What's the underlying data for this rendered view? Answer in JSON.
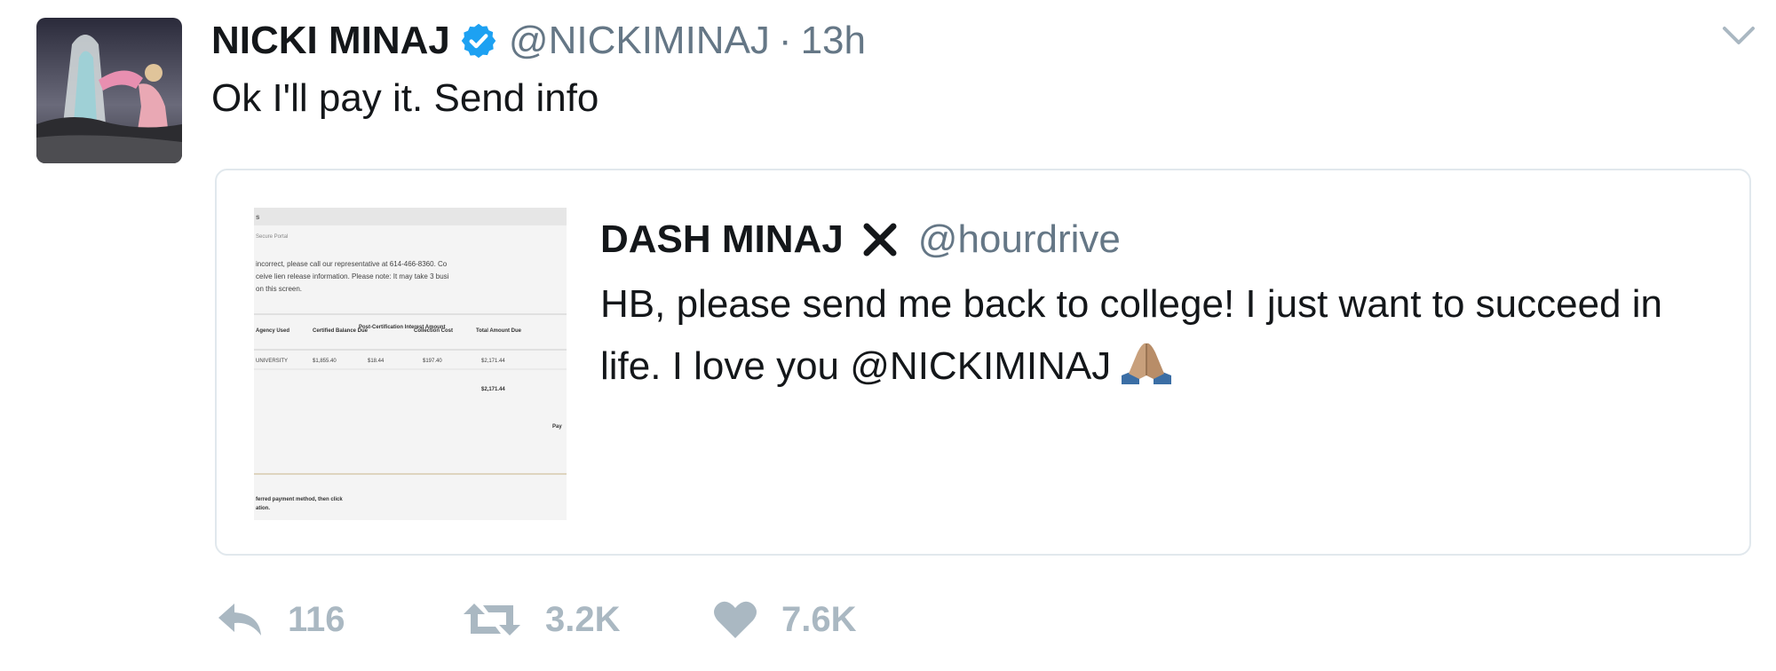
{
  "tweet": {
    "author_name": "NICKI MINAJ",
    "handle": "@NICKIMINAJ",
    "separator": "·",
    "time": "13h",
    "text": "Ok I'll pay it. Send info"
  },
  "quoted": {
    "author_name": "DASH MINAJ",
    "name_emoji": "heavy-x-icon",
    "handle": "@hourdrive",
    "text": "HB, please send me back to college! I just want to succeed in life. I love you @NICKIMINAJ",
    "emoji": "folded-hands-icon",
    "image": {
      "lines": [
        "incorrect, please call our representative at 614-466-8360. Co",
        "ceive lien release information. Please note: It may take 3 busi",
        "on this screen."
      ],
      "table_headers": [
        "Agency Used",
        "Certified Balance Due",
        "Post-Certification Interest Amount",
        "Collection Cost",
        "Total Amount Due"
      ],
      "table_row": [
        "UNIVERSITY",
        "$1,855.40",
        "$18.44",
        "$197.40",
        "$2,171.44"
      ],
      "total": "$2,171.44",
      "footer": "ferred payment method, then click"
    }
  },
  "actions": {
    "reply_count": "116",
    "retweet_count": "3.2K",
    "like_count": "7.6K"
  },
  "colors": {
    "verified": "#1da1f2",
    "muted": "#657786",
    "action": "#aab8c2",
    "border": "#e1e8ed"
  }
}
